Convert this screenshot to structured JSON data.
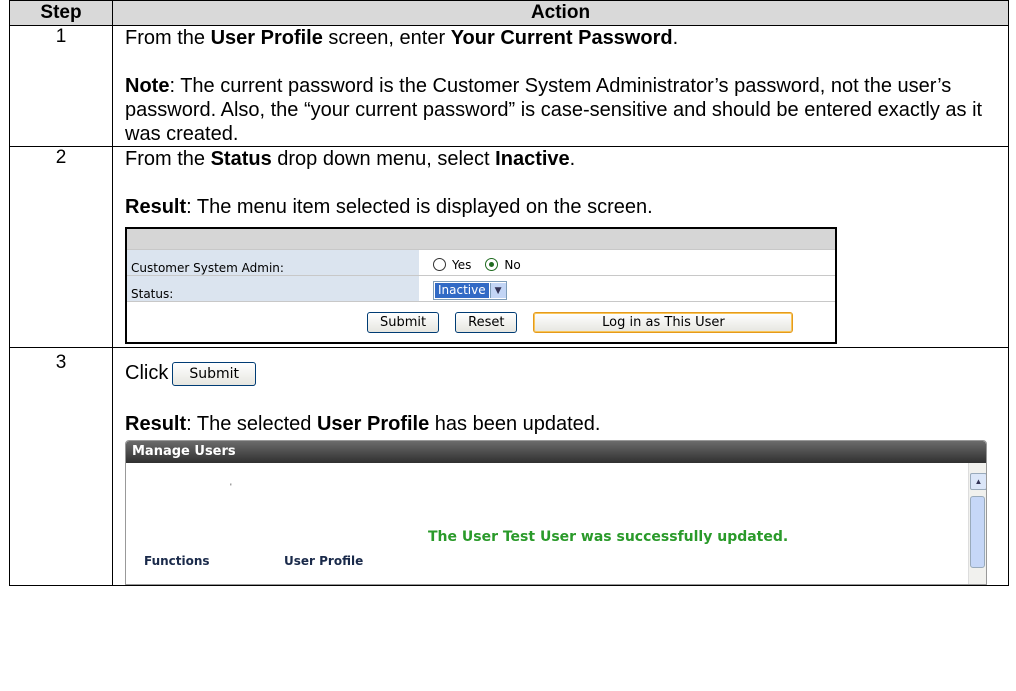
{
  "header": {
    "step": "Step",
    "action": "Action"
  },
  "rows": {
    "r1": {
      "step": "1",
      "line1_pre": "From the ",
      "line1_b1": "User Profile",
      "line1_mid": " screen, enter ",
      "line1_b2": "Your Current Password",
      "line1_post": ".",
      "note_label": "Note",
      "note_text": ":  The current password is the Customer System Administrator’s password, not the user’s password.  Also, the “your current password” is case-sensitive and should be entered exactly as it was created."
    },
    "r2": {
      "step": "2",
      "line1_pre": "From the ",
      "line1_b1": "Status",
      "line1_mid": " drop down menu, select ",
      "line1_b2": "Inactive",
      "line1_post": ".",
      "result_label": "Result",
      "result_text": ":  The menu item selected is displayed on the screen.",
      "form": {
        "admin_label": "Customer System Admin:",
        "yes": "Yes",
        "no": "No",
        "status_label": "Status:",
        "status_value": "Inactive",
        "submit": "Submit",
        "reset": "Reset",
        "login_as": "Log in as This User"
      }
    },
    "r3": {
      "step": "3",
      "click": "Click",
      "submit_btn": "Submit",
      "result_label": "Result",
      "result_pre": ":  The selected ",
      "result_b": "User Profile",
      "result_post": " has been updated.",
      "panel": {
        "title": "Manage Users",
        "tick": "'",
        "message": "The User Test User was successfully updated.",
        "functions": "Functions",
        "user_profile": "User Profile"
      }
    }
  }
}
